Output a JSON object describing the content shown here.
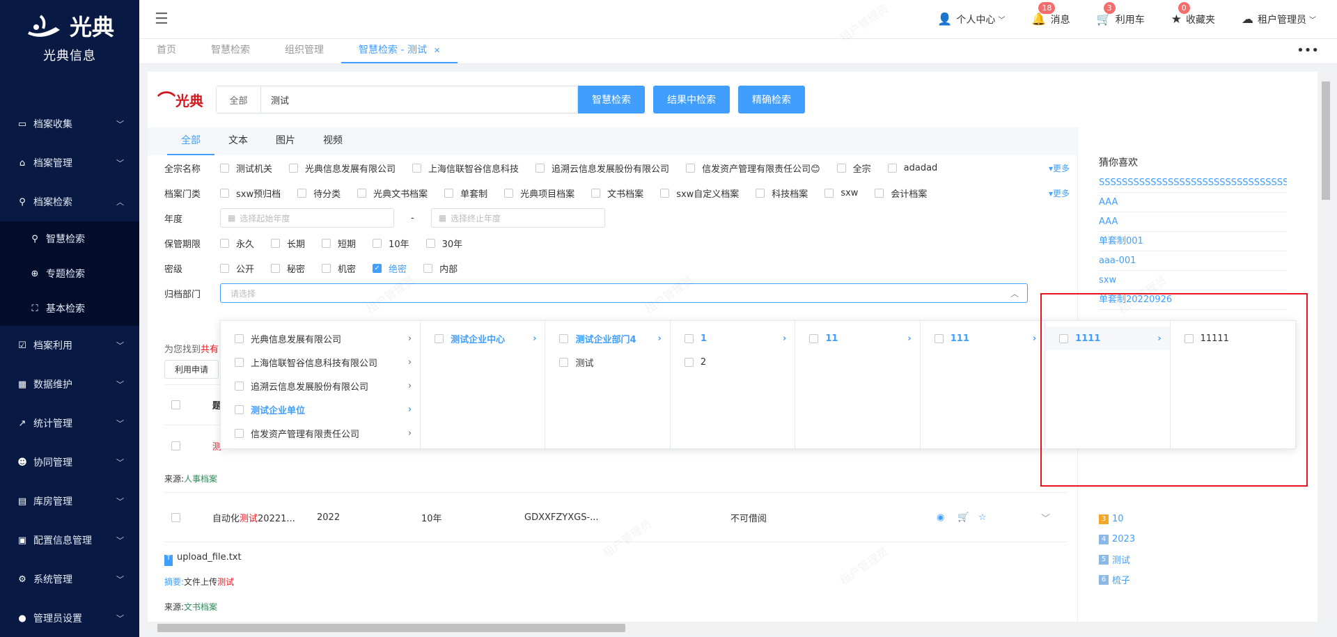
{
  "brand": {
    "logo_text": "光典",
    "name": "光典信息"
  },
  "sidebar": {
    "items": [
      {
        "label": "档案收集",
        "icon": "folder-icon"
      },
      {
        "label": "档案管理",
        "icon": "bank-icon"
      },
      {
        "label": "档案检索",
        "icon": "search-icon"
      }
    ],
    "sub": [
      {
        "label": "智慧检索",
        "icon": "search-icon"
      },
      {
        "label": "专题检索",
        "icon": "compass-icon"
      },
      {
        "label": "基本检索",
        "icon": "scan-icon"
      }
    ],
    "items2": [
      {
        "label": "档案利用"
      },
      {
        "label": "数据维护"
      },
      {
        "label": "统计管理"
      },
      {
        "label": "协同管理"
      },
      {
        "label": "库房管理"
      },
      {
        "label": "配置信息管理"
      },
      {
        "label": "系统管理"
      },
      {
        "label": "管理员设置"
      }
    ]
  },
  "topbar": {
    "personal": "个人中心",
    "msg": "消息",
    "msg_count": "18",
    "cart": "利用车",
    "cart_count": "3",
    "fav": "收藏夹",
    "fav_count": "0",
    "user": "租户管理员"
  },
  "tabs": [
    "首页",
    "智慧检索",
    "组织管理",
    "智慧检索 - 测试"
  ],
  "search": {
    "scope": "全部",
    "query": "测试",
    "btn1": "智慧检索",
    "btn2": "结果中检索",
    "btn3": "精确检索"
  },
  "content_tabs": [
    "全部",
    "文本",
    "图片",
    "视频"
  ],
  "filters": {
    "quanzong_label": "全宗名称",
    "quanzong": [
      "测试机关",
      "光典信息发展有限公司",
      "上海信联智谷信息科技",
      "追溯云信息发展股份有限公司",
      "信发资产管理有限责任公司😊",
      "全宗",
      "adadad"
    ],
    "menlei_label": "档案门类",
    "menlei": [
      "sxw预归档",
      "待分类",
      "光典文书档案",
      "单套制",
      "光典项目档案",
      "文书档案",
      "sxw自定义档案",
      "科技档案",
      "sxw",
      "会计档案"
    ],
    "more": "▾更多",
    "year_label": "年度",
    "year_start": "选择起始年度",
    "year_end": "选择终止年度",
    "dash": "-",
    "period_label": "保管期限",
    "period": [
      "永久",
      "长期",
      "短期",
      "10年",
      "30年"
    ],
    "secret_label": "密级",
    "secret": [
      "公开",
      "秘密",
      "机密",
      "绝密",
      "内部"
    ],
    "dept_label": "归档部门",
    "dept_placeholder": "请选择"
  },
  "results": {
    "found": "为您找到",
    "found_hl": "共有",
    "apply": "利用申请",
    "source1": "来源:",
    "source1_val": "人事档案",
    "row_title": "自动化",
    "row_title_hl": "测试",
    "row_title_tail": "20221...",
    "row_year": "2022",
    "row_period": "10年",
    "row_code": "GDXXFZYXGS-...",
    "row_status": "不可借阅",
    "file": "upload_file.txt",
    "abstract": "摘要:",
    "abstract_val": "文件上传",
    "abstract_hl": "测试",
    "source2": "来源:",
    "source2_val": "文书档案",
    "col_title": "题",
    "first_hl": "测"
  },
  "cascader": {
    "c1": [
      "光典信息发展有限公司",
      "上海信联智谷信息科技有限公司",
      "追溯云信息发展股份有限公司",
      "测试企业单位",
      "信发资产管理有限责任公司"
    ],
    "c2": [
      "测试企业中心"
    ],
    "c3": [
      "测试企业部门4",
      "测试"
    ],
    "c4": [
      "1",
      "2"
    ],
    "c5": [
      "11"
    ],
    "c6": [
      "111"
    ],
    "c7": [
      "1111"
    ],
    "c8": [
      "11111"
    ]
  },
  "recommend": {
    "title": "猜你喜欢",
    "items": [
      "SSSSSSSSSSSSSSSSSSSSSSSSSSSSSSSSSSSSSS",
      "AAA",
      "AAA",
      "单套制001",
      "aaa-001",
      "sxw",
      "单套制20220926"
    ],
    "rank": [
      {
        "n": "3",
        "t": "10"
      },
      {
        "n": "4",
        "t": "2023"
      },
      {
        "n": "5",
        "t": "测试"
      },
      {
        "n": "6",
        "t": "梳子"
      }
    ]
  },
  "watermark": "租户管理员"
}
